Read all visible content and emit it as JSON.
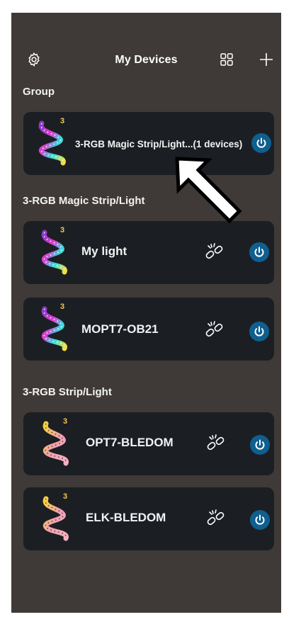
{
  "header": {
    "title": "My Devices"
  },
  "sections": {
    "group": "Group",
    "magic": "3-RGB Magic Strip/Light",
    "rgb": "3-RGB Strip/Light"
  },
  "group_card": {
    "name": "3-RGB Magic Strip/Light...(1 devices)",
    "badge": "3"
  },
  "devices": [
    {
      "name": "My light",
      "badge": "3"
    },
    {
      "name": "MOPT7-OB21",
      "badge": "3"
    },
    {
      "name": "OPT7-BLEDOM",
      "badge": "3"
    },
    {
      "name": "ELK-BLEDOM",
      "badge": "3"
    }
  ],
  "icons": {
    "settings": "gear-icon",
    "grid": "grid-icon",
    "add": "plus-icon",
    "power": "power-icon",
    "link": "broken-link-icon",
    "pointer": "arrow-pointer-icon"
  },
  "colors": {
    "background": "#3f3a37",
    "card": "#1b1f24",
    "power_button": "#0f5f8f",
    "badge": "#f5c84d"
  }
}
